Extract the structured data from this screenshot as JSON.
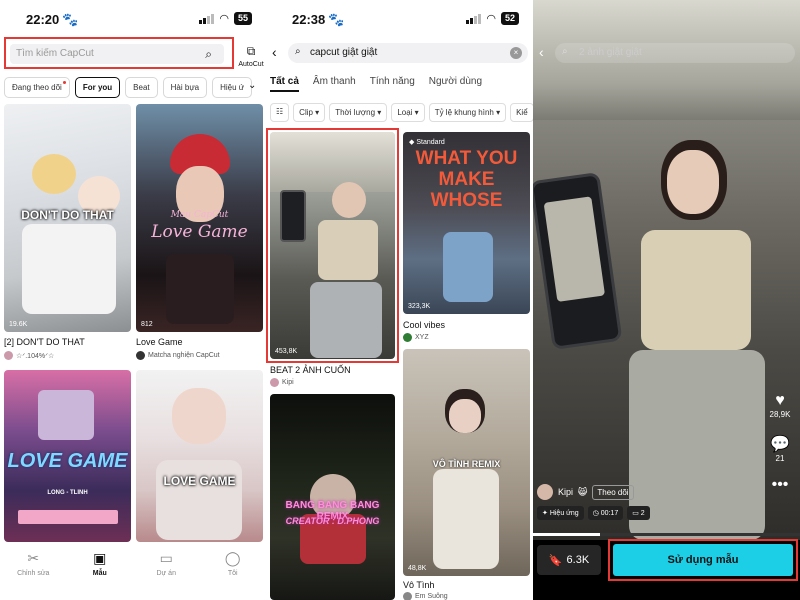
{
  "panel1": {
    "status": {
      "time": "22:20",
      "battery": "55"
    },
    "search": {
      "placeholder": "Tìm kiếm CapCut"
    },
    "autocut": "AutoCut",
    "chips": [
      "Đang theo dõi",
      "For you",
      "Beat",
      "Hài bựa",
      "Hiệu ứ"
    ],
    "active_chip": "For you",
    "cards": [
      {
        "overlay": "DON'T DO THAT",
        "count": "19.6K",
        "title": "[2] DON'T DO THAT",
        "author": "☆ᐟ.104%ᐟ☆"
      },
      {
        "overlay_top": "Mau CapCut",
        "overlay": "Love Game",
        "count": "812",
        "title": "Love Game",
        "author": "Matcha nghiện CapCut"
      },
      {
        "overlay": "LOVE GAME",
        "sub": "LONG - TLINH"
      },
      {
        "overlay": "LOVE GAME"
      }
    ],
    "nav": [
      "Chỉnh sửa",
      "Mẫu",
      "Dự án",
      "Tôi"
    ]
  },
  "panel2": {
    "status": {
      "time": "22:38",
      "battery": "52"
    },
    "search": {
      "value": "capcut giật giật"
    },
    "tabs": [
      "Tất cả",
      "Âm thanh",
      "Tính năng",
      "Người dùng"
    ],
    "filters": [
      "Clip",
      "Thời lượng",
      "Loại",
      "Tỷ lệ khung hình",
      "Kiể"
    ],
    "cards": [
      {
        "count": "453,8K",
        "title": "BEAT 2 ẢNH CUỐN",
        "author": "Kipi"
      },
      {
        "badge": "Standard",
        "overlay": "WHAT YOU MAKE WHOSE",
        "count": "323,3K",
        "title": "Cool vibes",
        "author": "XYZ"
      },
      {
        "overlay": "BANG BANG BANG REMIX",
        "overlay2": "CREATOR : D.PHONG"
      },
      {
        "overlay": "VÔ TÌNH REMIX",
        "count": "48,8K",
        "title": "Vô Tình",
        "author": "Em Suông"
      }
    ]
  },
  "panel3": {
    "search": {
      "value": "2 ảnh giật giật"
    },
    "likes": "28,9K",
    "comments": "21",
    "creator": "Kipi",
    "follow": "Theo dõi",
    "tags": [
      "Hiệu ứng",
      "00:17",
      "2"
    ],
    "progress": 0.25,
    "saves": "6.3K",
    "use_button": "Sử dụng mẫu"
  }
}
